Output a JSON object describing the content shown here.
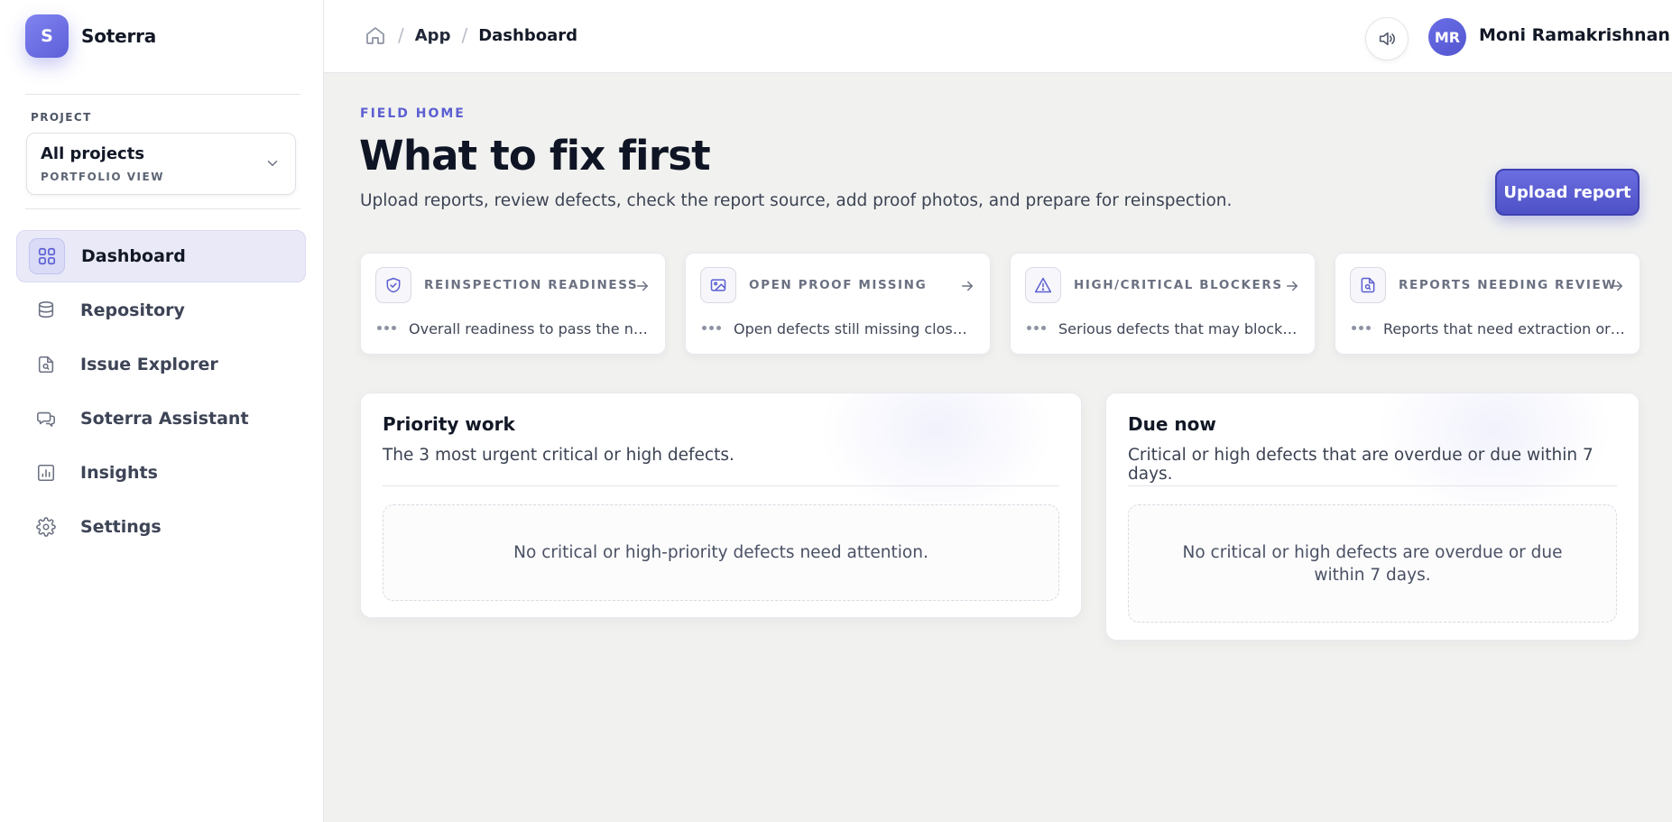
{
  "brand": {
    "logo_letter": "S",
    "name": "Soterra"
  },
  "project": {
    "label": "PROJECT",
    "selected": "All projects",
    "sub": "PORTFOLIO VIEW"
  },
  "nav": [
    {
      "label": "Dashboard",
      "icon": "grid-icon",
      "active": true
    },
    {
      "label": "Repository",
      "icon": "database-icon",
      "active": false
    },
    {
      "label": "Issue Explorer",
      "icon": "document-search-icon",
      "active": false
    },
    {
      "label": "Soterra Assistant",
      "icon": "chat-icon",
      "active": false
    },
    {
      "label": "Insights",
      "icon": "bar-chart-icon",
      "active": false
    },
    {
      "label": "Settings",
      "icon": "gear-icon",
      "active": false
    }
  ],
  "breadcrumb": {
    "app": "App",
    "current": "Dashboard"
  },
  "user": {
    "initials": "MR",
    "name": "Moni Ramakrishnan"
  },
  "header": {
    "eyebrow": "FIELD HOME",
    "title": "What to fix first",
    "subtitle": "Upload reports, review defects, check the report source, add proof photos, and prepare for reinspection.",
    "upload_label": "Upload report"
  },
  "metrics": [
    {
      "title": "REINSPECTION READINESS",
      "icon": "shield-check-icon",
      "desc": "Overall readiness to pass the next reinspection"
    },
    {
      "title": "OPEN PROOF MISSING",
      "icon": "image-icon",
      "desc": "Open defects still missing close-out proof"
    },
    {
      "title": "HIGH/CRITICAL BLOCKERS",
      "icon": "warning-icon",
      "desc": "Serious defects that may block handover"
    },
    {
      "title": "REPORTS NEEDING REVIEW",
      "icon": "document-search-icon",
      "desc": "Reports that need extraction or review"
    }
  ],
  "priority": {
    "title": "Priority work",
    "subtitle": "The 3 most urgent critical or high defects.",
    "empty": "No critical or high-priority defects need attention."
  },
  "due": {
    "title": "Due now",
    "subtitle": "Critical or high defects that are overdue or due within 7 days.",
    "empty": "No critical or high defects are overdue or due within 7 days."
  },
  "colors": {
    "accent": "#5c5fd1",
    "background": "#f1f2f0"
  }
}
